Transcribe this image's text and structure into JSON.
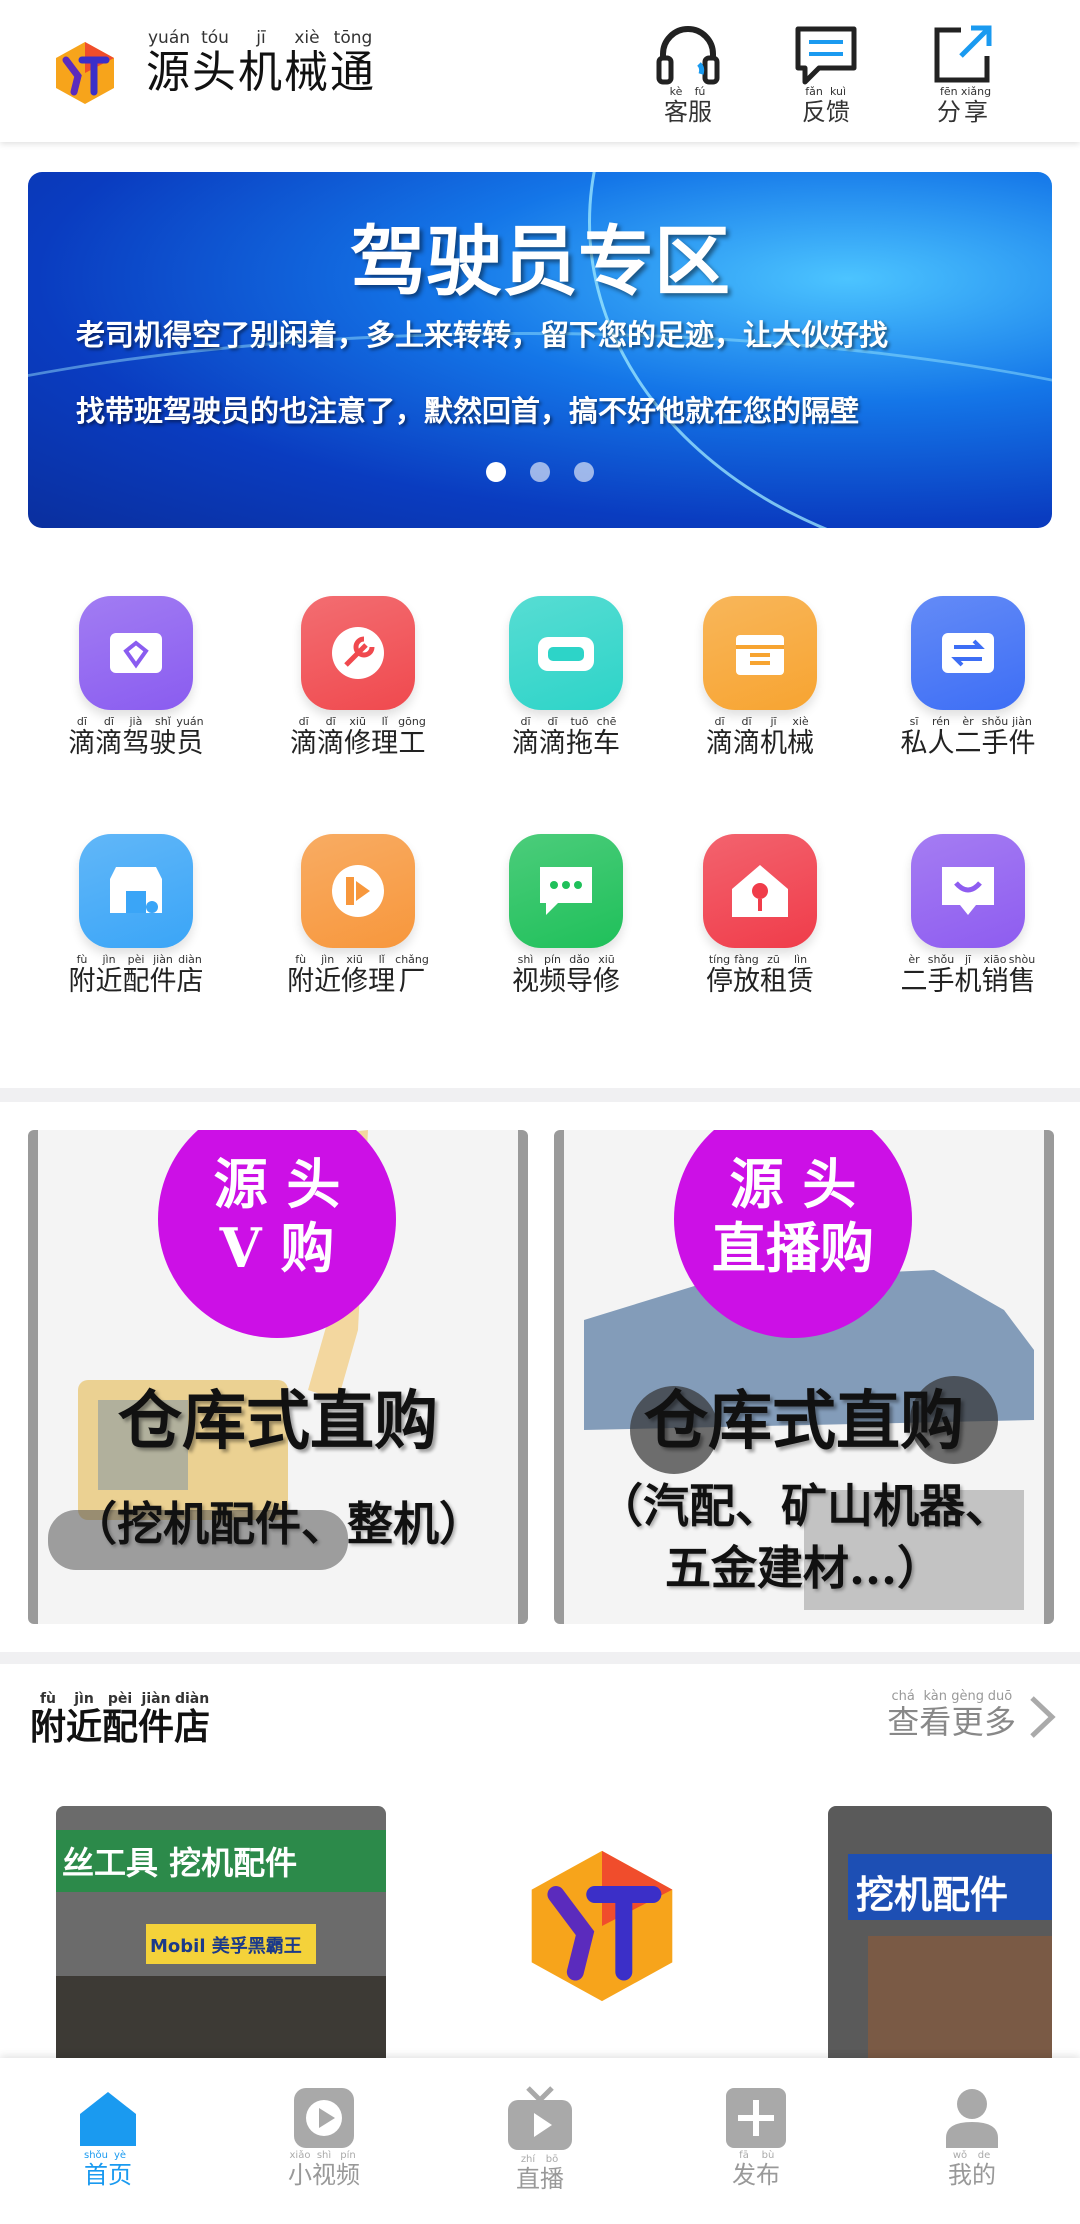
{
  "header": {
    "title_chars": [
      "源",
      "头",
      "机",
      "械",
      "通"
    ],
    "title_pinyin": [
      "yuán",
      "tóu",
      "jī",
      "xiè",
      "tōng"
    ],
    "actions": [
      {
        "chars": [
          "客",
          "服"
        ],
        "pinyin": [
          "kè",
          "fú"
        ],
        "icon": "headset-icon"
      },
      {
        "chars": [
          "反",
          "馈"
        ],
        "pinyin": [
          "fǎn",
          "kuì"
        ],
        "icon": "feedback-icon"
      },
      {
        "chars": [
          "分",
          "享"
        ],
        "pinyin": [
          "fēn",
          "xiǎng"
        ],
        "icon": "share-icon"
      }
    ]
  },
  "banner": {
    "title": "驾驶员专区",
    "line1": "老司机得空了别闲着，多上来转转，留下您的足迹，让大伙好找",
    "line2": "找带班驾驶员的也注意了，默然回首，搞不好他就在您的隔壁",
    "slide_count": 3,
    "active_slide": 1
  },
  "grid": [
    {
      "chars": [
        "滴",
        "滴",
        "驾",
        "驶",
        "员"
      ],
      "pinyin": [
        "dī",
        "dī",
        "jià",
        "shǐ",
        "yuán"
      ],
      "icon": "diamond-wallet-icon",
      "color": "#8a5cf0"
    },
    {
      "chars": [
        "滴",
        "滴",
        "修",
        "理",
        "工"
      ],
      "pinyin": [
        "dī",
        "dī",
        "xiū",
        "lǐ",
        "gōng"
      ],
      "icon": "wrench-icon",
      "color": "#f0494e"
    },
    {
      "chars": [
        "滴",
        "滴",
        "拖",
        "车"
      ],
      "pinyin": [
        "dī",
        "dī",
        "tuō",
        "chē"
      ],
      "icon": "vr-goggles-icon",
      "color": "#2dd4c8"
    },
    {
      "chars": [
        "滴",
        "滴",
        "机",
        "械"
      ],
      "pinyin": [
        "dī",
        "dī",
        "jī",
        "xiè"
      ],
      "icon": "box-icon",
      "color": "#f7a431"
    },
    {
      "chars": [
        "私",
        "人",
        "二",
        "手",
        "件"
      ],
      "pinyin": [
        "sī",
        "rén",
        "èr",
        "shǒu",
        "jiàn"
      ],
      "icon": "exchange-icon",
      "color": "#3d6ef5"
    },
    {
      "chars": [
        "附",
        "近",
        "配",
        "件",
        "店"
      ],
      "pinyin": [
        "fù",
        "jìn",
        "pèi",
        "jiàn",
        "diàn"
      ],
      "icon": "store-icon",
      "color": "#3aa5f7"
    },
    {
      "chars": [
        "附",
        "近",
        "修",
        "理",
        "厂"
      ],
      "pinyin": [
        "fù",
        "jìn",
        "xiū",
        "lǐ",
        "chǎng"
      ],
      "icon": "factory-icon",
      "color": "#f7973c"
    },
    {
      "chars": [
        "视",
        "频",
        "导",
        "修"
      ],
      "pinyin": [
        "shì",
        "pín",
        "dǎo",
        "xiū"
      ],
      "icon": "chat-bubble-icon",
      "color": "#1fc05a"
    },
    {
      "chars": [
        "停",
        "放",
        "租",
        "赁"
      ],
      "pinyin": [
        "tíng",
        "fàng",
        "zū",
        "lìn"
      ],
      "icon": "home-pin-icon",
      "color": "#f03c4a"
    },
    {
      "chars": [
        "二",
        "手",
        "机",
        "销",
        "售"
      ],
      "pinyin": [
        "èr",
        "shǒu",
        "jī",
        "xiāo",
        "shòu"
      ],
      "icon": "smile-message-icon",
      "color": "#8e5cf0"
    }
  ],
  "promos": [
    {
      "circle_line1": "源 头",
      "circle_line2": "V 购",
      "main": "仓库式直购",
      "sub1": "（挖机配件、整机）",
      "sub2": ""
    },
    {
      "circle_line1": "源 头",
      "circle_line2": "直播购",
      "main": "仓库式直购",
      "sub1": "（汽配、矿山机器、",
      "sub2": "五金建材...）"
    }
  ],
  "nearby": {
    "title_chars": [
      "附",
      "近",
      "配",
      "件",
      "店"
    ],
    "title_pinyin": [
      "fù",
      "jìn",
      "pèi",
      "jiàn",
      "diàn"
    ],
    "more_chars": [
      "查",
      "看",
      "更",
      "多"
    ],
    "more_pinyin": [
      "chá",
      "kàn",
      "gèng",
      "duō"
    ],
    "shop1_sign": "丝工具 挖机配件",
    "shop1_sub": "Mobil 美孚黑霸王",
    "shop3_sign": "挖机配件"
  },
  "bottom_nav": [
    {
      "chars": [
        "首",
        "页"
      ],
      "pinyin": [
        "shǒu",
        "yè"
      ],
      "icon": "home-icon",
      "active": true
    },
    {
      "chars": [
        "小",
        "视",
        "频"
      ],
      "pinyin": [
        "xiǎo",
        "shì",
        "pín"
      ],
      "icon": "play-icon",
      "active": false
    },
    {
      "chars": [
        "直",
        "播"
      ],
      "pinyin": [
        "zhí",
        "bō"
      ],
      "icon": "tv-icon",
      "active": false
    },
    {
      "chars": [
        "发",
        "布"
      ],
      "pinyin": [
        "fā",
        "bù"
      ],
      "icon": "plus-icon",
      "active": false
    },
    {
      "chars": [
        "我",
        "的"
      ],
      "pinyin": [
        "wǒ",
        "de"
      ],
      "icon": "user-icon",
      "active": false
    }
  ],
  "colors": {
    "accent": "#1a9af0",
    "promo_circle": "#cc10e6",
    "banner_blue": "#1476e8"
  }
}
